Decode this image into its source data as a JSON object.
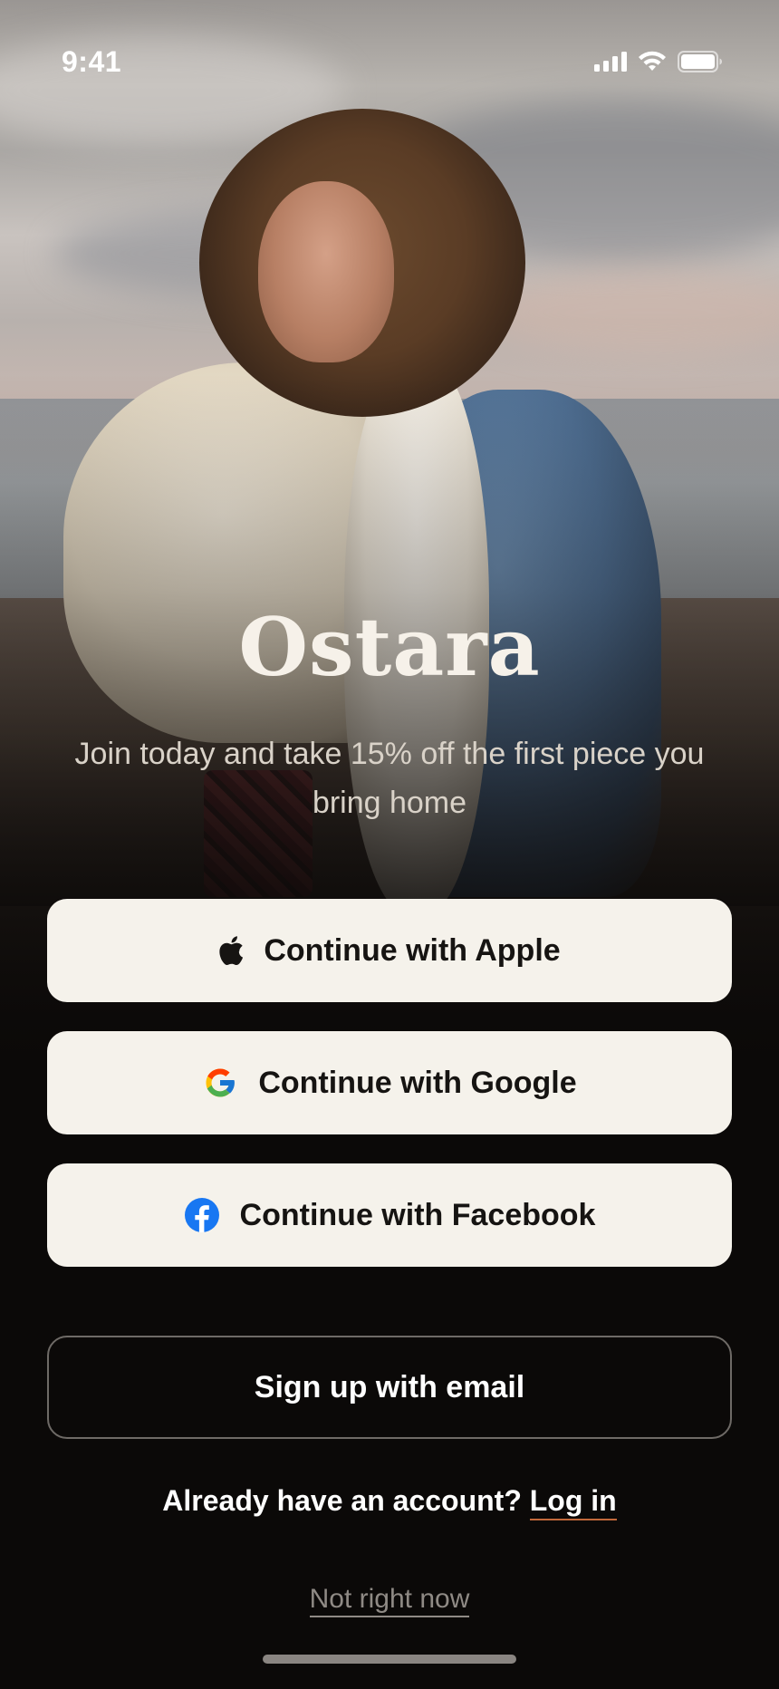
{
  "status_bar": {
    "time": "9:41",
    "icons": [
      "cellular-signal-icon",
      "wifi-icon",
      "battery-icon"
    ]
  },
  "hero": {
    "image": "woman-with-curly-hair-on-beach-photo"
  },
  "brand": {
    "name": "Ostara",
    "tagline": "Join today and take 15% off the first piece you bring home"
  },
  "auth": {
    "apple_label": "Continue with Apple",
    "google_label": "Continue with Google",
    "facebook_label": "Continue with Facebook",
    "email_label": "Sign up with email"
  },
  "login": {
    "prompt": "Already have an account?",
    "link": "Log in"
  },
  "skip": {
    "label": "Not right now"
  },
  "colors": {
    "background": "#0b0908",
    "button_light": "#f5f2eb",
    "brand_text": "#f6f1e9",
    "link_underline": "#c1683a",
    "facebook_blue": "#1877f2"
  }
}
